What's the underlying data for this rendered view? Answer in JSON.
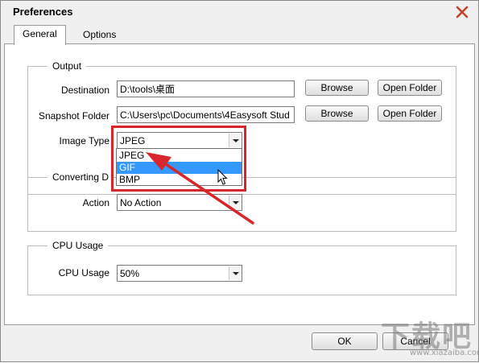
{
  "window": {
    "title": "Preferences"
  },
  "tabs": [
    {
      "label": "General",
      "active": true
    },
    {
      "label": "Options",
      "active": false
    }
  ],
  "output": {
    "group_label": "Output",
    "destination_label": "Destination",
    "destination_value": "D:\\tools\\桌面",
    "snapshot_label": "Snapshot Folder",
    "snapshot_value": "C:\\Users\\pc\\Documents\\4Easysoft Stud",
    "browse_label": "Browse",
    "open_folder_label": "Open Folder",
    "image_type_label": "Image Type",
    "image_type_value": "JPEG",
    "image_type_options": [
      "JPEG",
      "GIF",
      "BMP"
    ],
    "image_type_highlighted": "GIF"
  },
  "converting": {
    "group_label": "Converting D",
    "action_label": "Action",
    "action_value": "No Action"
  },
  "cpu": {
    "group_label": "CPU Usage",
    "usage_label": "CPU Usage",
    "usage_value": "50%"
  },
  "footer": {
    "ok_label": "OK",
    "cancel_label": "Cancel"
  },
  "watermark": {
    "brand": "下载吧",
    "url": "www.xiazaiba.com"
  },
  "colors": {
    "annotation": "#d7262c",
    "selection": "#3399ff"
  }
}
